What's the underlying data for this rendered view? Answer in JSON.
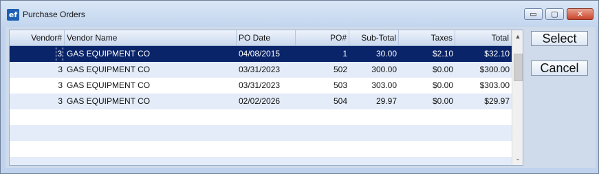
{
  "window": {
    "icon": "ef",
    "title": "Purchase Orders",
    "controls": {
      "minimize": "▭",
      "maximize": "▢",
      "close": "✕"
    }
  },
  "grid": {
    "columns": [
      "Vendor#",
      "Vendor Name",
      "PO Date",
      "PO#",
      "Sub-Total",
      "Taxes",
      "Total"
    ],
    "rows": [
      {
        "vendor": "3",
        "name": "GAS EQUIPMENT CO",
        "date": "04/08/2015",
        "po": "1",
        "subtotal": "30.00",
        "taxes": "$2.10",
        "total": "$32.10"
      },
      {
        "vendor": "3",
        "name": "GAS EQUIPMENT CO",
        "date": "03/31/2023",
        "po": "502",
        "subtotal": "300.00",
        "taxes": "$0.00",
        "total": "$300.00"
      },
      {
        "vendor": "3",
        "name": "GAS EQUIPMENT CO",
        "date": "03/31/2023",
        "po": "503",
        "subtotal": "303.00",
        "taxes": "$0.00",
        "total": "$303.00"
      },
      {
        "vendor": "3",
        "name": "GAS EQUIPMENT CO",
        "date": "02/02/2026",
        "po": "504",
        "subtotal": "29.97",
        "taxes": "$0.00",
        "total": "$29.97"
      }
    ],
    "selected_row": 1
  },
  "scrollbar": {
    "up": "▲",
    "down": "⌄"
  },
  "buttons": {
    "select": "Select",
    "cancel": "Cancel"
  }
}
